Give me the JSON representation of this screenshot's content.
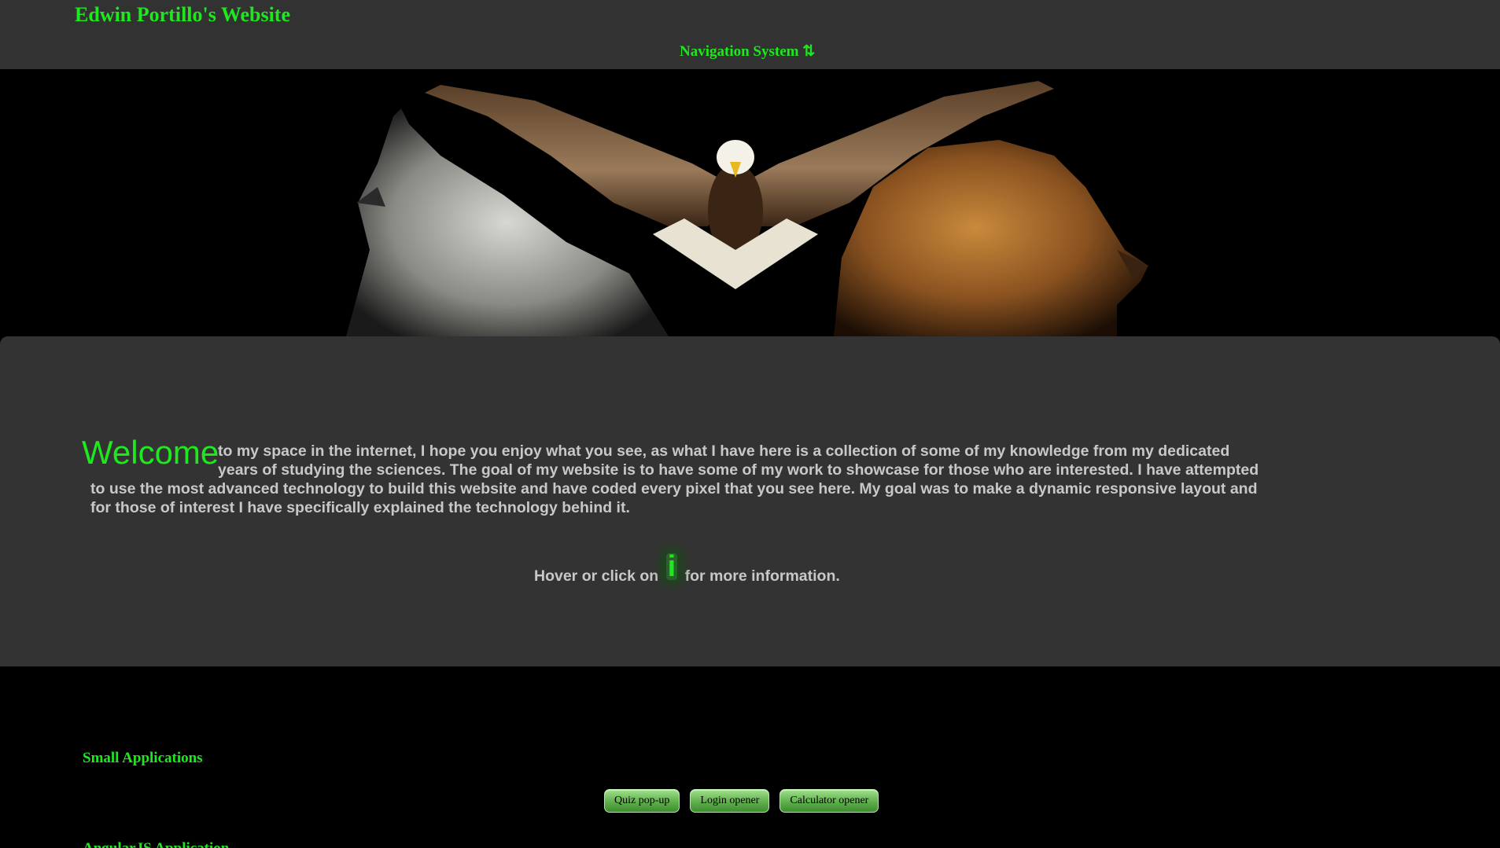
{
  "header": {
    "site_title": "Edwin Portillo's Website",
    "nav_label": "Navigation System ⇅"
  },
  "hero": {
    "image": "wolf-eagle-lion-banner"
  },
  "welcome": {
    "heading": "Welcome",
    "lines": [
      "to my space in the internet, I hope you enjoy what you see, as what I have here is a collection of some of my knowledge from my dedicated",
      "years of studying the sciences. The goal of my website is to have some of my work to showcase for those who are interested. I have attempted",
      "to use the most advanced technology to build this website and have coded every pixel that you see here. My goal was to make a dynamic responsive layout and",
      "for those of interest I have specifically explained the technology behind it."
    ],
    "hover_prefix": "Hover or click on",
    "info_letter": "i",
    "hover_suffix": "for more information."
  },
  "sections": {
    "small_apps_heading": "Small Applications",
    "angular_heading": "AngularJS Application",
    "buttons": [
      "Quiz pop-up",
      "Login opener",
      "Calculator opener"
    ]
  },
  "colors": {
    "accent": "#1ee81e",
    "panel": "#333333",
    "topbar": "#323232",
    "text": "#c8c8c8"
  }
}
